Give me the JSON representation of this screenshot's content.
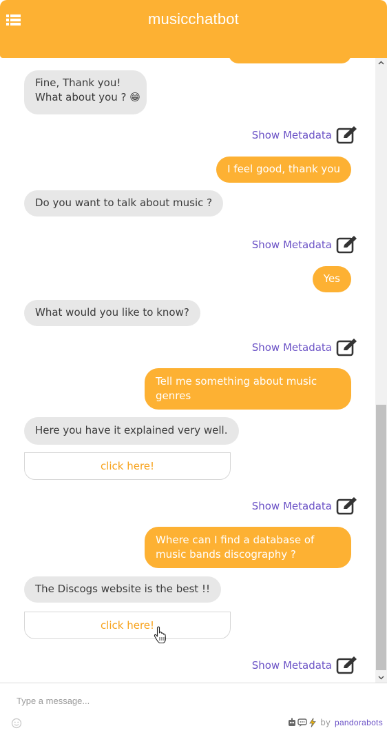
{
  "header": {
    "title": "musicchatbot",
    "menu_icon": "list-icon"
  },
  "colors": {
    "accent": "#fdb133",
    "bot_bubble": "#e7e7e7",
    "link_purple": "#6b52c6",
    "button_text": "#f7a21b"
  },
  "messages": {
    "m1": {
      "line1": "Fine, Thank you!",
      "line2": "What about you ? 😁"
    },
    "m2": "I feel good, thank you",
    "m3": "Do you want to talk about music ?",
    "m4": "Yes",
    "m5": "What would you like to know?",
    "m6": "Tell me something about music genres",
    "m7": "Here you have it explained very well.",
    "m8": "Where can I find a database of music bands discography ?",
    "m9": "The Discogs website is the best !!"
  },
  "meta_label": "Show Metadata",
  "meta_icon": "edit-icon",
  "link_button_label": "click here!",
  "input": {
    "placeholder": "Type a message..."
  },
  "footer": {
    "by": "by",
    "brand": "pandorabots"
  }
}
